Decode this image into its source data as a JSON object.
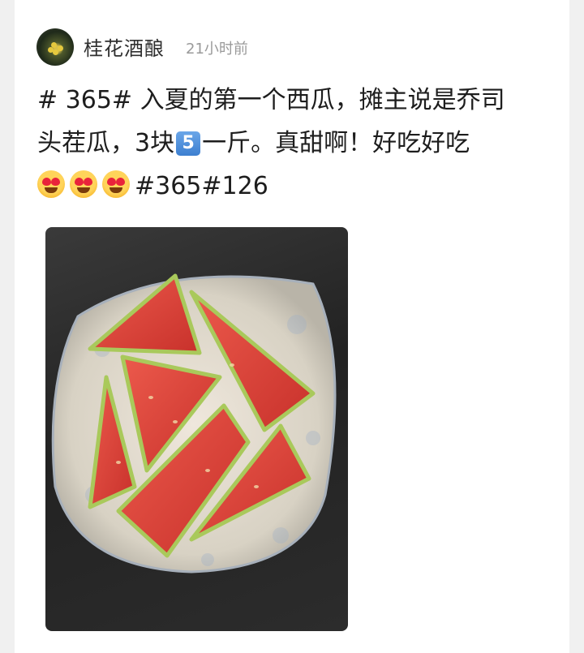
{
  "post": {
    "author": "桂花酒酿",
    "time": "21小时前",
    "line1": "# 365# 入夏的第一个西瓜，摊主说是乔司",
    "line2_a": "头茬瓜，3块",
    "keycap": "5",
    "line2_b": "一斤。真甜啊！好吃好吃",
    "line3_tags": "#365#126"
  },
  "icons": {
    "avatar": "osmanthus-photo-icon",
    "keycap": "keycap-5-icon",
    "emoji": "heart-eyes-emoji-icon"
  },
  "colors": {
    "author": "#2f2f2f",
    "time": "#9a9a9a",
    "text": "#1d1d1d",
    "watermelon_red": "#e04a3f",
    "rind_green": "#a9c95b"
  }
}
